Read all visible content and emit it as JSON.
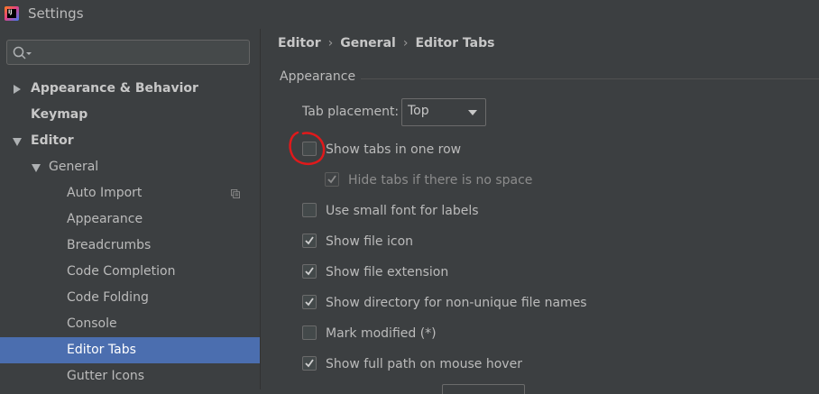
{
  "window": {
    "title": "Settings"
  },
  "search": {
    "placeholder": ""
  },
  "sidebar": {
    "items": [
      {
        "label": "Appearance & Behavior",
        "bold": true,
        "expanded": false
      },
      {
        "label": "Keymap",
        "bold": true
      },
      {
        "label": "Editor",
        "bold": true,
        "expanded": true
      },
      {
        "label": "General",
        "expanded": true
      },
      {
        "label": "Auto Import"
      },
      {
        "label": "Appearance"
      },
      {
        "label": "Breadcrumbs"
      },
      {
        "label": "Code Completion"
      },
      {
        "label": "Code Folding"
      },
      {
        "label": "Console"
      },
      {
        "label": "Editor Tabs",
        "selected": true
      },
      {
        "label": "Gutter Icons"
      }
    ]
  },
  "breadcrumb": {
    "items": [
      "Editor",
      "General",
      "Editor Tabs"
    ],
    "separator": "›"
  },
  "section": {
    "title": "Appearance"
  },
  "tab_placement": {
    "label": "Tab placement:",
    "value": "Top"
  },
  "options": [
    {
      "label": "Show tabs in one row",
      "checked": false,
      "enabled": true
    },
    {
      "label": "Hide tabs if there is no space",
      "checked": true,
      "enabled": false
    },
    {
      "label": "Use small font for labels",
      "checked": false,
      "enabled": true
    },
    {
      "label": "Show file icon",
      "checked": true,
      "enabled": true
    },
    {
      "label": "Show file extension",
      "checked": true,
      "enabled": true
    },
    {
      "label": "Show directory for non-unique file names",
      "checked": true,
      "enabled": true
    },
    {
      "label": "Mark modified (*)",
      "checked": false,
      "enabled": true
    },
    {
      "label": "Show full path on mouse hover",
      "checked": true,
      "enabled": true
    }
  ],
  "colors": {
    "selection": "#4b6eaf",
    "annotation": "#e0191b",
    "background": "#3c3f41"
  }
}
